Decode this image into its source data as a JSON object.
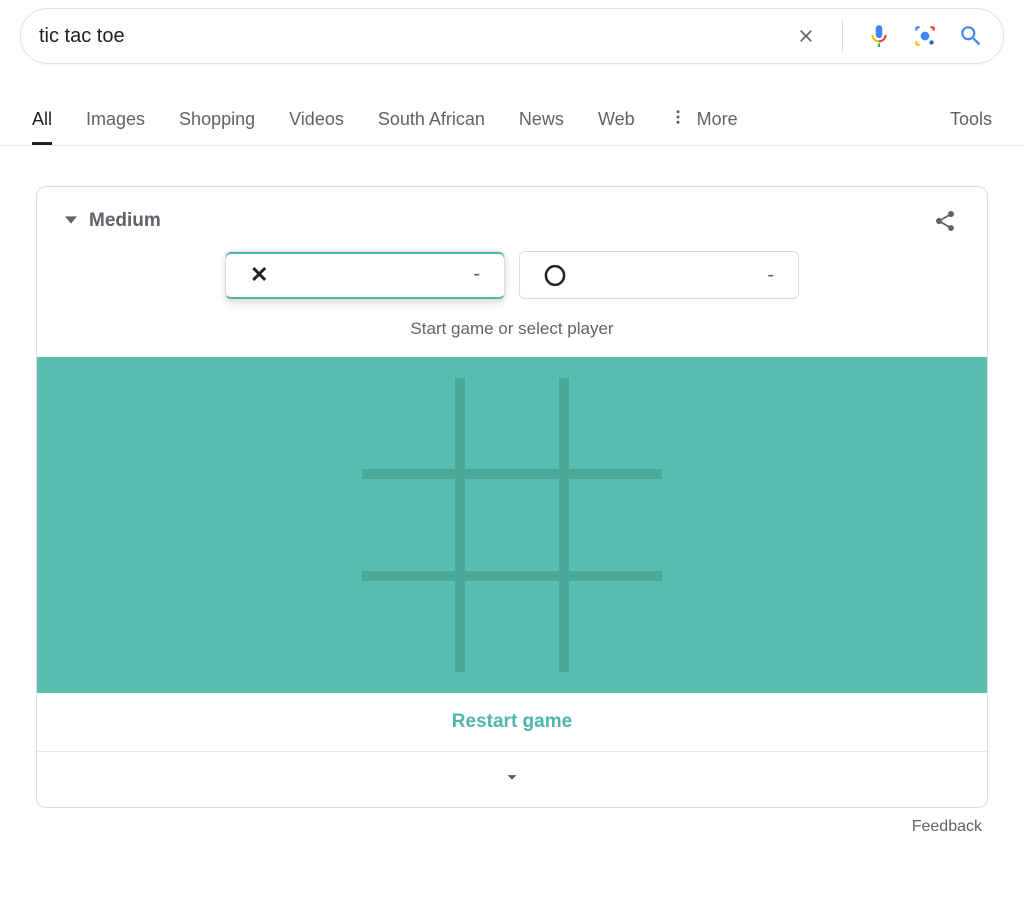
{
  "search": {
    "query": "tic tac toe"
  },
  "tabs": {
    "all": "All",
    "images": "Images",
    "shopping": "Shopping",
    "videos": "Videos",
    "south_african": "South African",
    "news": "News",
    "web": "Web",
    "more": "More",
    "tools": "Tools"
  },
  "game": {
    "difficulty": "Medium",
    "playerX": {
      "symbol": "✕",
      "score": "-"
    },
    "playerO": {
      "symbol": "〇",
      "score": "-"
    },
    "instruction": "Start game or select player",
    "restart": "Restart game",
    "board": [
      "",
      "",
      "",
      "",
      "",
      "",
      "",
      "",
      ""
    ],
    "accent_color": "#56bfaf"
  },
  "footer": {
    "feedback": "Feedback"
  },
  "icons": {
    "clear": "clear-icon",
    "mic": "mic-icon",
    "lens": "lens-icon",
    "search": "search-icon",
    "share": "share-icon",
    "chevron_down": "chevron-down-icon",
    "more_dots": "more-dots-icon",
    "dropdown_arrow": "dropdown-arrow-icon"
  }
}
